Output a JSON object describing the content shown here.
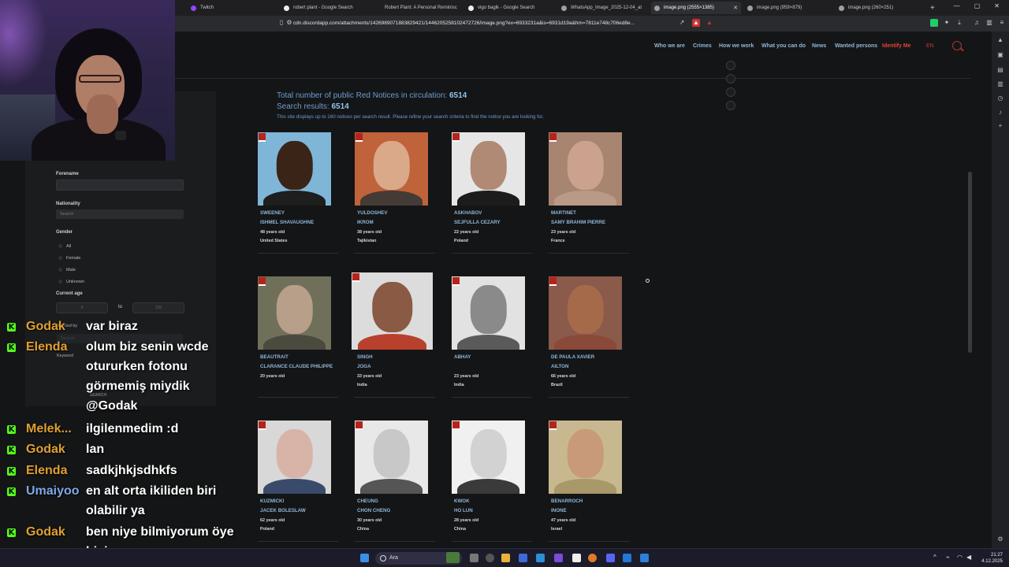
{
  "browser": {
    "tabs": [
      {
        "label": "Twitch",
        "active": false
      },
      {
        "label": "robert plant - Google Search",
        "active": false
      },
      {
        "label": "Robert Plant: A Personal Reminisc",
        "active": false
      },
      {
        "label": "vigo baglk - Google Search",
        "active": false
      },
      {
        "label": "WhatsApp_Image_2025-12-04_at",
        "active": false
      },
      {
        "label": "image.png (2555×1385)",
        "active": true
      },
      {
        "label": "image.png (959×879)",
        "active": false
      },
      {
        "label": "image.png (260×251)",
        "active": false
      }
    ],
    "new_tab": "+",
    "url": "cdn.discordapp.com/attachments/1426989071883829421/1446205258102472726/image.png?ex=6933231a&is=6931d19a&hm=7811e748c706ed8e..."
  },
  "nav": {
    "items": [
      "Who we are",
      "Crimes",
      "How we work",
      "What you can do",
      "News",
      "Wanted persons",
      "Identify Me"
    ],
    "lang": "EN"
  },
  "summary": {
    "total_label": "Total number of public Red Notices in circulation:",
    "total_value": "6514",
    "results_label": "Search results:",
    "results_value": "6514",
    "info": "This site displays up to 160 notices per search result. Please refine your search criteria to find the notice you are looking for."
  },
  "filters": {
    "forename_label": "Forename",
    "nationality_label": "Nationality",
    "nationality_placeholder": "Search",
    "gender_label": "Gender",
    "gender_options": [
      "All",
      "Female",
      "Male",
      "Unknown"
    ],
    "age_label": "Current age",
    "age_min": "0",
    "age_to": "to",
    "age_max": "120",
    "wanted_by_label": "Wanted by",
    "wanted_by_placeholder": "Search",
    "keyword_label": "Keyword",
    "search_button": "SEARCH"
  },
  "notices": [
    {
      "surname": "SWEENEY",
      "given": "ISHMEL SHAVAUGHNE",
      "age": "48 years old",
      "nationality": "United States"
    },
    {
      "surname": "YULDOSHEV",
      "given": "IKROM",
      "age": "38 years old",
      "nationality": "Tajikistan"
    },
    {
      "surname": "ASKHABOV",
      "given": "SEJFULLA CEZARY",
      "age": "22 years old",
      "nationality": "Poland"
    },
    {
      "surname": "MARTINET",
      "given": "SAMY BRAHIM PIERRE",
      "age": "23 years old",
      "nationality": "France"
    },
    {
      "surname": "BEAUTRAIT",
      "given": "CLARANCE CLAUDE PHILIPPE",
      "age": "20 years old",
      "nationality": ""
    },
    {
      "surname": "SINGH",
      "given": "JOGA",
      "age": "33 years old",
      "nationality": "India"
    },
    {
      "surname": "ABHAY",
      "given": "",
      "age": "23 years old",
      "nationality": "India"
    },
    {
      "surname": "DE PAULA XAVIER",
      "given": "AILTON",
      "age": "66 years old",
      "nationality": "Brazil"
    },
    {
      "surname": "KUZMICKI",
      "given": "JACEK BOLESLAW",
      "age": "62 years old",
      "nationality": "Poland"
    },
    {
      "surname": "CHEUNG",
      "given": "CHON CHENG",
      "age": "30 years old",
      "nationality": "China"
    },
    {
      "surname": "KWOK",
      "given": "HO LUN",
      "age": "28 years old",
      "nationality": "China"
    },
    {
      "surname": "BENARROCH",
      "given": "INONE",
      "age": "47 years old",
      "nationality": "Israel"
    }
  ],
  "chat": [
    {
      "user": "Godak",
      "text": "var biraz",
      "color": "#e0a030"
    },
    {
      "user": "Elenda",
      "text": "olum biz senin wcde otururken fotonu görmemiş miydik @Godak",
      "color": "#e0a030"
    },
    {
      "user": "Melek...",
      "text": "ilgilenmedim :d",
      "color": "#e0a030"
    },
    {
      "user": "Godak",
      "text": "lan",
      "color": "#e0a030"
    },
    {
      "user": "Elenda",
      "text": "sadkjhkjsdhkfs",
      "color": "#e0a030"
    },
    {
      "user": "Umaiyoo",
      "text": "en alt orta ikiliden biri olabilir ya",
      "color": "#7fa8e8"
    },
    {
      "user": "Godak",
      "text": "ben niye bilmiyorum öye bişi",
      "color": "#e0a030"
    }
  ],
  "chat_badge": "K",
  "taskbar": {
    "search_label": "Ara",
    "time": "21:27",
    "date": "4.12.2025"
  },
  "colors": {
    "accent": "#8fb6d8",
    "identify": "#e0443a",
    "kick_green": "#53fc18"
  }
}
